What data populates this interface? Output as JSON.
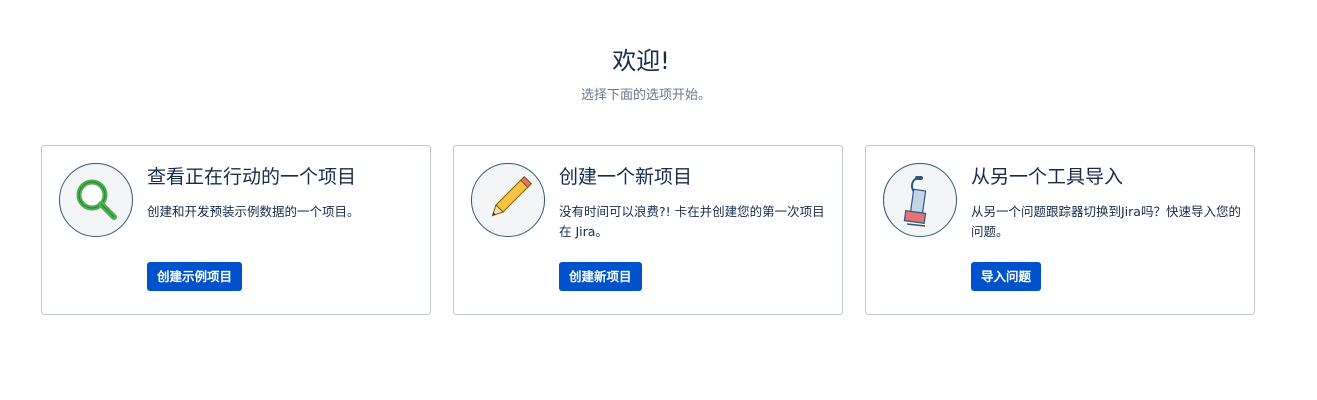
{
  "header": {
    "title": "欢迎!",
    "subtitle": "选择下面的选项开始。"
  },
  "cards": [
    {
      "icon": "magnifying-glass-icon",
      "title": "查看正在行动的一个项目",
      "description": "创建和开发预装示例数据的一个项目。",
      "button_label": "创建示例项目"
    },
    {
      "icon": "pencil-icon",
      "title": "创建一个新项目",
      "description": "没有时间可以浪费?! 卡在并创建您的第一次项目在 Jira。",
      "button_label": "创建新项目"
    },
    {
      "icon": "vacuum-cleaner-icon",
      "title": "从另一个工具导入",
      "description": "从另一个问题跟踪器切换到Jira吗？快速导入您的问题。",
      "button_label": "导入问题"
    }
  ],
  "colors": {
    "primary_button": "#0052cc",
    "text_primary": "#172b4d",
    "text_secondary": "#6b778c",
    "card_border": "#c1c7d0",
    "icon_ring": "#2f5782"
  }
}
